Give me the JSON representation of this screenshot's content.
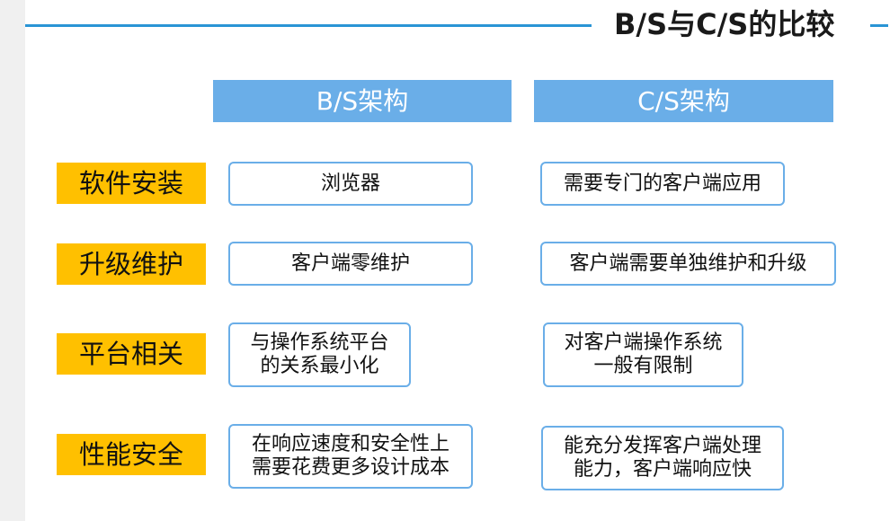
{
  "title": "B/S与C/S的比较",
  "columns": {
    "bs": "B/S架构",
    "cs": "C/S架构"
  },
  "rows": [
    {
      "label": "软件安装",
      "bs": "浏览器",
      "cs": "需要专门的客户端应用"
    },
    {
      "label": "升级维护",
      "bs": "客户端零维护",
      "cs": "客户端需要单独维护和升级"
    },
    {
      "label": "平台相关",
      "bs": "与操作系统平台\n的关系最小化",
      "cs": "对客户端操作系统\n一般有限制"
    },
    {
      "label": "性能安全",
      "bs": "在响应速度和安全性上\n需要花费更多设计成本",
      "cs": "能充分发挥客户端处理\n能力，客户端响应快"
    }
  ]
}
